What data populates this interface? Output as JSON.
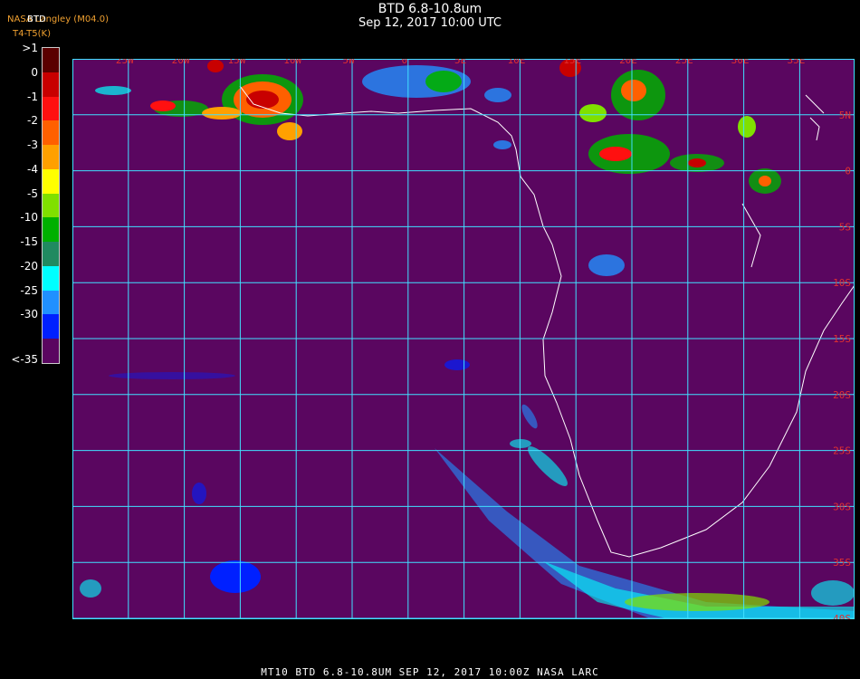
{
  "header": {
    "title": "BTD 6.8-10.8um",
    "subtitle": "Sep 12, 2017 10:00 UTC",
    "credit": "NASA Langley (M04.0)",
    "product": "BTD",
    "legend_label": "T4-T5(K)"
  },
  "legend": [
    {
      "label": ">1",
      "color": "#5a0000"
    },
    {
      "label": "0",
      "color": "#c80000"
    },
    {
      "label": "-1",
      "color": "#ff1010"
    },
    {
      "label": "-2",
      "color": "#ff6000"
    },
    {
      "label": "-3",
      "color": "#ffa000"
    },
    {
      "label": "-4",
      "color": "#ffff00"
    },
    {
      "label": "-5",
      "color": "#80e000"
    },
    {
      "label": "-10",
      "color": "#00b000"
    },
    {
      "label": "-15",
      "color": "#208a60"
    },
    {
      "label": "-20",
      "color": "#00ffff"
    },
    {
      "label": "-25",
      "color": "#2090ff"
    },
    {
      "label": "-30",
      "color": "#0020ff"
    },
    {
      "label": "<-35",
      "color": "#5a0660"
    }
  ],
  "map": {
    "background_color": "#5a0660",
    "grid_color": "#40e0ff",
    "coast_color": "#ffffff",
    "label_color": "#e03030",
    "lon_labels": [
      "25W",
      "20W",
      "15W",
      "10W",
      "5W",
      "0",
      "5E",
      "10E",
      "15E",
      "20E",
      "25E",
      "30E",
      "35E"
    ],
    "lat_labels": [
      "5N",
      "0",
      "5S",
      "10S",
      "15S",
      "20S",
      "25S",
      "30S",
      "35S",
      "40S"
    ]
  },
  "footer": {
    "text": "MT10  BTD 6.8-10.8UM   SEP 12, 2017 10:00Z   NASA LARC"
  }
}
